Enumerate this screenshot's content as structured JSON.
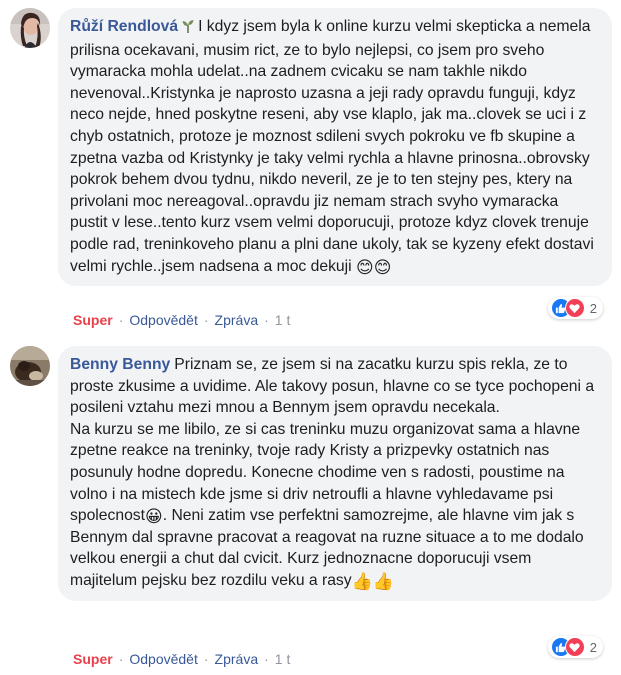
{
  "comments": [
    {
      "author": "Růží Rendlová",
      "author_badge_icon": "sprout-icon",
      "text": "I kdyz jsem byla k online kurzu velmi skepticka a nemela prilisna ocekavani, musim rict, ze to bylo nejlepsi, co jsem pro sveho vymaracka mohla udelat..na zadnem cvicaku se nam takhle nikdo nevenoval..Kristynka je naprosto uzasna a jeji rady opravdu funguji, kdyz neco nejde, hned poskytne reseni, aby vse klaplo, jak ma..clovek se uci i z chyb ostatnich, protoze je moznost sdileni svych pokroku ve fb skupine a zpetna vazba od Kristynky je taky velmi rychla a hlavne prinosna..obrovsky pokrok behem dvou tydnu, nikdo neveril, ze je to ten stejny pes, ktery na privolani moc nereagoval..opravdu jiz nemam strach svyho vymaracka pustit v lese..tento kurz vsem velmi doporucuji, protoze kdyz clovek trenuje podle rad, treninkoveho planu a plni dane ukoly, tak se kyzeny efekt dostavi velmi rychle..jsem nadsena a moc dekuji",
      "trailing_emoji": "😊😊",
      "reaction_count": "2",
      "actions": {
        "super": "Super",
        "reply": "Odpovědět",
        "report": "Zpráva",
        "time": "1 t"
      }
    },
    {
      "author": "Benny Benny",
      "text_1": "Priznam se, ze jsem si na zacatku kurzu spis rekla, ze to proste zkusime a uvidime. Ale takovy posun, hlavne co se tyce pochopeni a posileni vztahu mezi mnou a Bennym jsem opravdu necekala.\nNa kurzu se me libilo, ze si cas treninku muzu organizovat sama a hlavne zpetne reakce na treninky, tvoje rady Kristy a prizpevky ostatnich nas posunuly hodne dopredu. Konecne chodime ven s radosti, poustime na volno i na mistech kde jsme si driv netroufli a hlavne vyhledavame psi spolecnost",
      "emoji_1": "😀",
      "text_2": ". Neni zatim vse perfektni samozrejme, ale hlavne vim jak s Bennym dal spravne pracovat a reagovat na ruzne situace a to me dodalo velkou energii a chut dal cvicit. Kurz jednoznacne doporucuji vsem majitelum pejsku bez rozdilu veku a rasy",
      "trailing_emoji": "👍👍",
      "reaction_count": "2",
      "actions": {
        "super": "Super",
        "reply": "Odpovědět",
        "report": "Zpráva",
        "time": "1 t"
      }
    }
  ],
  "colors": {
    "author": "#385898",
    "bubble": "#f2f3f5",
    "super": "#e9414b",
    "like": "#1877f2",
    "love": "#f33e58"
  },
  "separator": "·"
}
